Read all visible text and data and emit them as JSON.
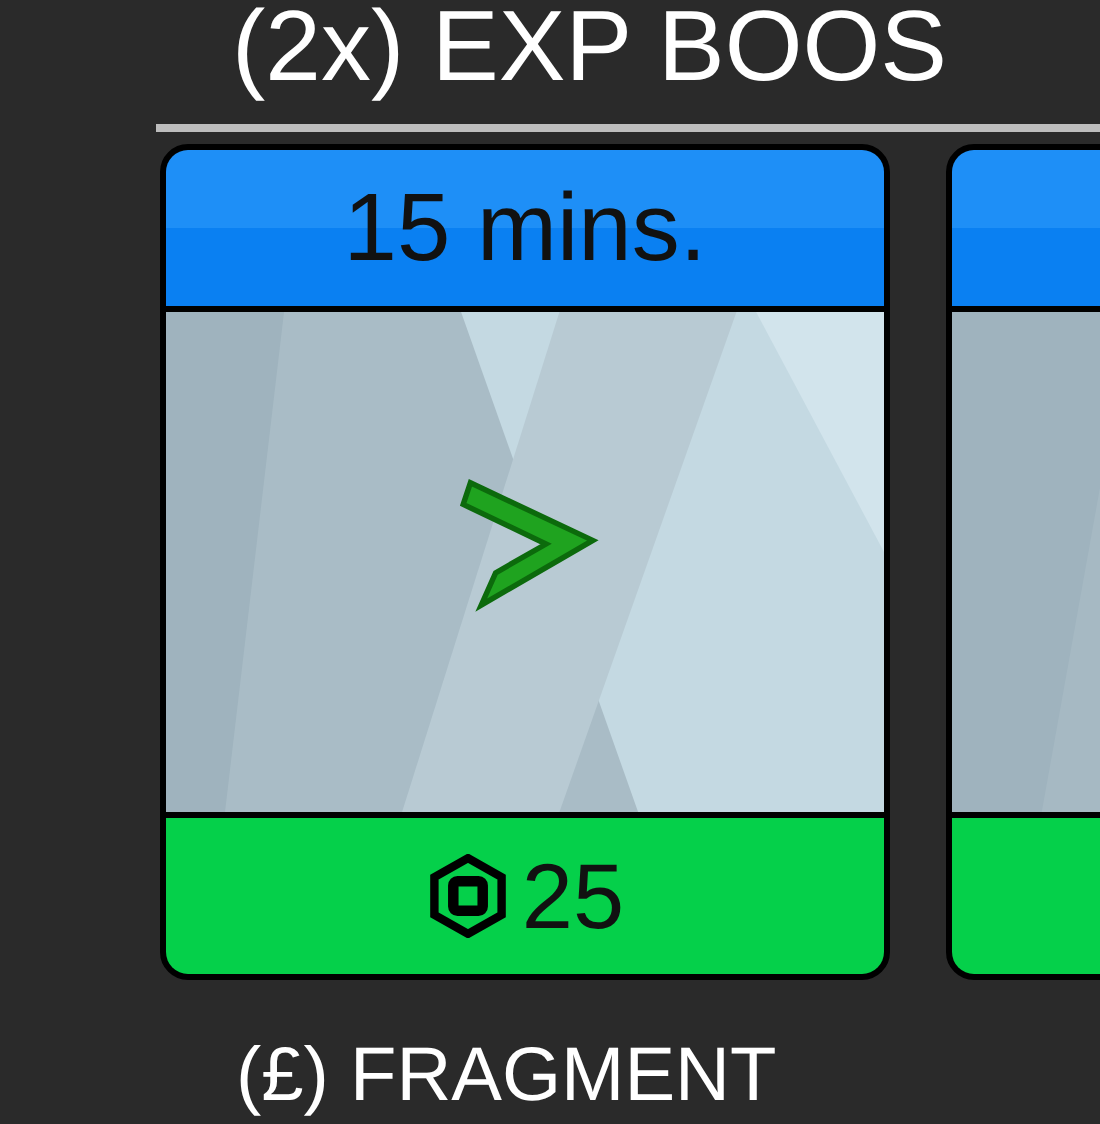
{
  "section_title": "(2x) EXP BOOS",
  "cards": [
    {
      "duration": "15 mins.",
      "price": "25",
      "kind": "item"
    },
    {
      "kind": "partial"
    }
  ],
  "next_section_title": "(£) FRAGMENT"
}
